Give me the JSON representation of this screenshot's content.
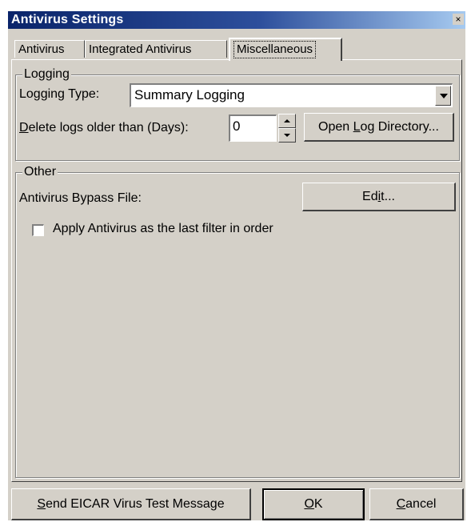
{
  "window": {
    "title": "Antivirus Settings",
    "close_glyph": "×"
  },
  "tabs": [
    {
      "label": "Antivirus"
    },
    {
      "label": "Integrated Antivirus"
    },
    {
      "label": "Miscellaneous"
    }
  ],
  "logging": {
    "group_label": "Logging",
    "type_label": "Logging Type:",
    "type_value": "Summary Logging",
    "delete_prefix": "D",
    "delete_rest": "elete logs older than (Days):",
    "delete_value": "0",
    "open_dir_pre": "Open ",
    "open_dir_key": "L",
    "open_dir_post": "og Directory..."
  },
  "other": {
    "group_label": "Other",
    "bypass_label": "Antivirus Bypass File:",
    "edit_pre": "Ed",
    "edit_key": "i",
    "edit_post": "t...",
    "checkbox_label": "Apply Antivirus as the last filter in order",
    "checkbox_checked": false
  },
  "footer": {
    "eicar_key": "S",
    "eicar_rest": "end EICAR Virus Test Message",
    "ok_key": "O",
    "ok_rest": "K",
    "cancel_key": "C",
    "cancel_rest": "ancel"
  }
}
